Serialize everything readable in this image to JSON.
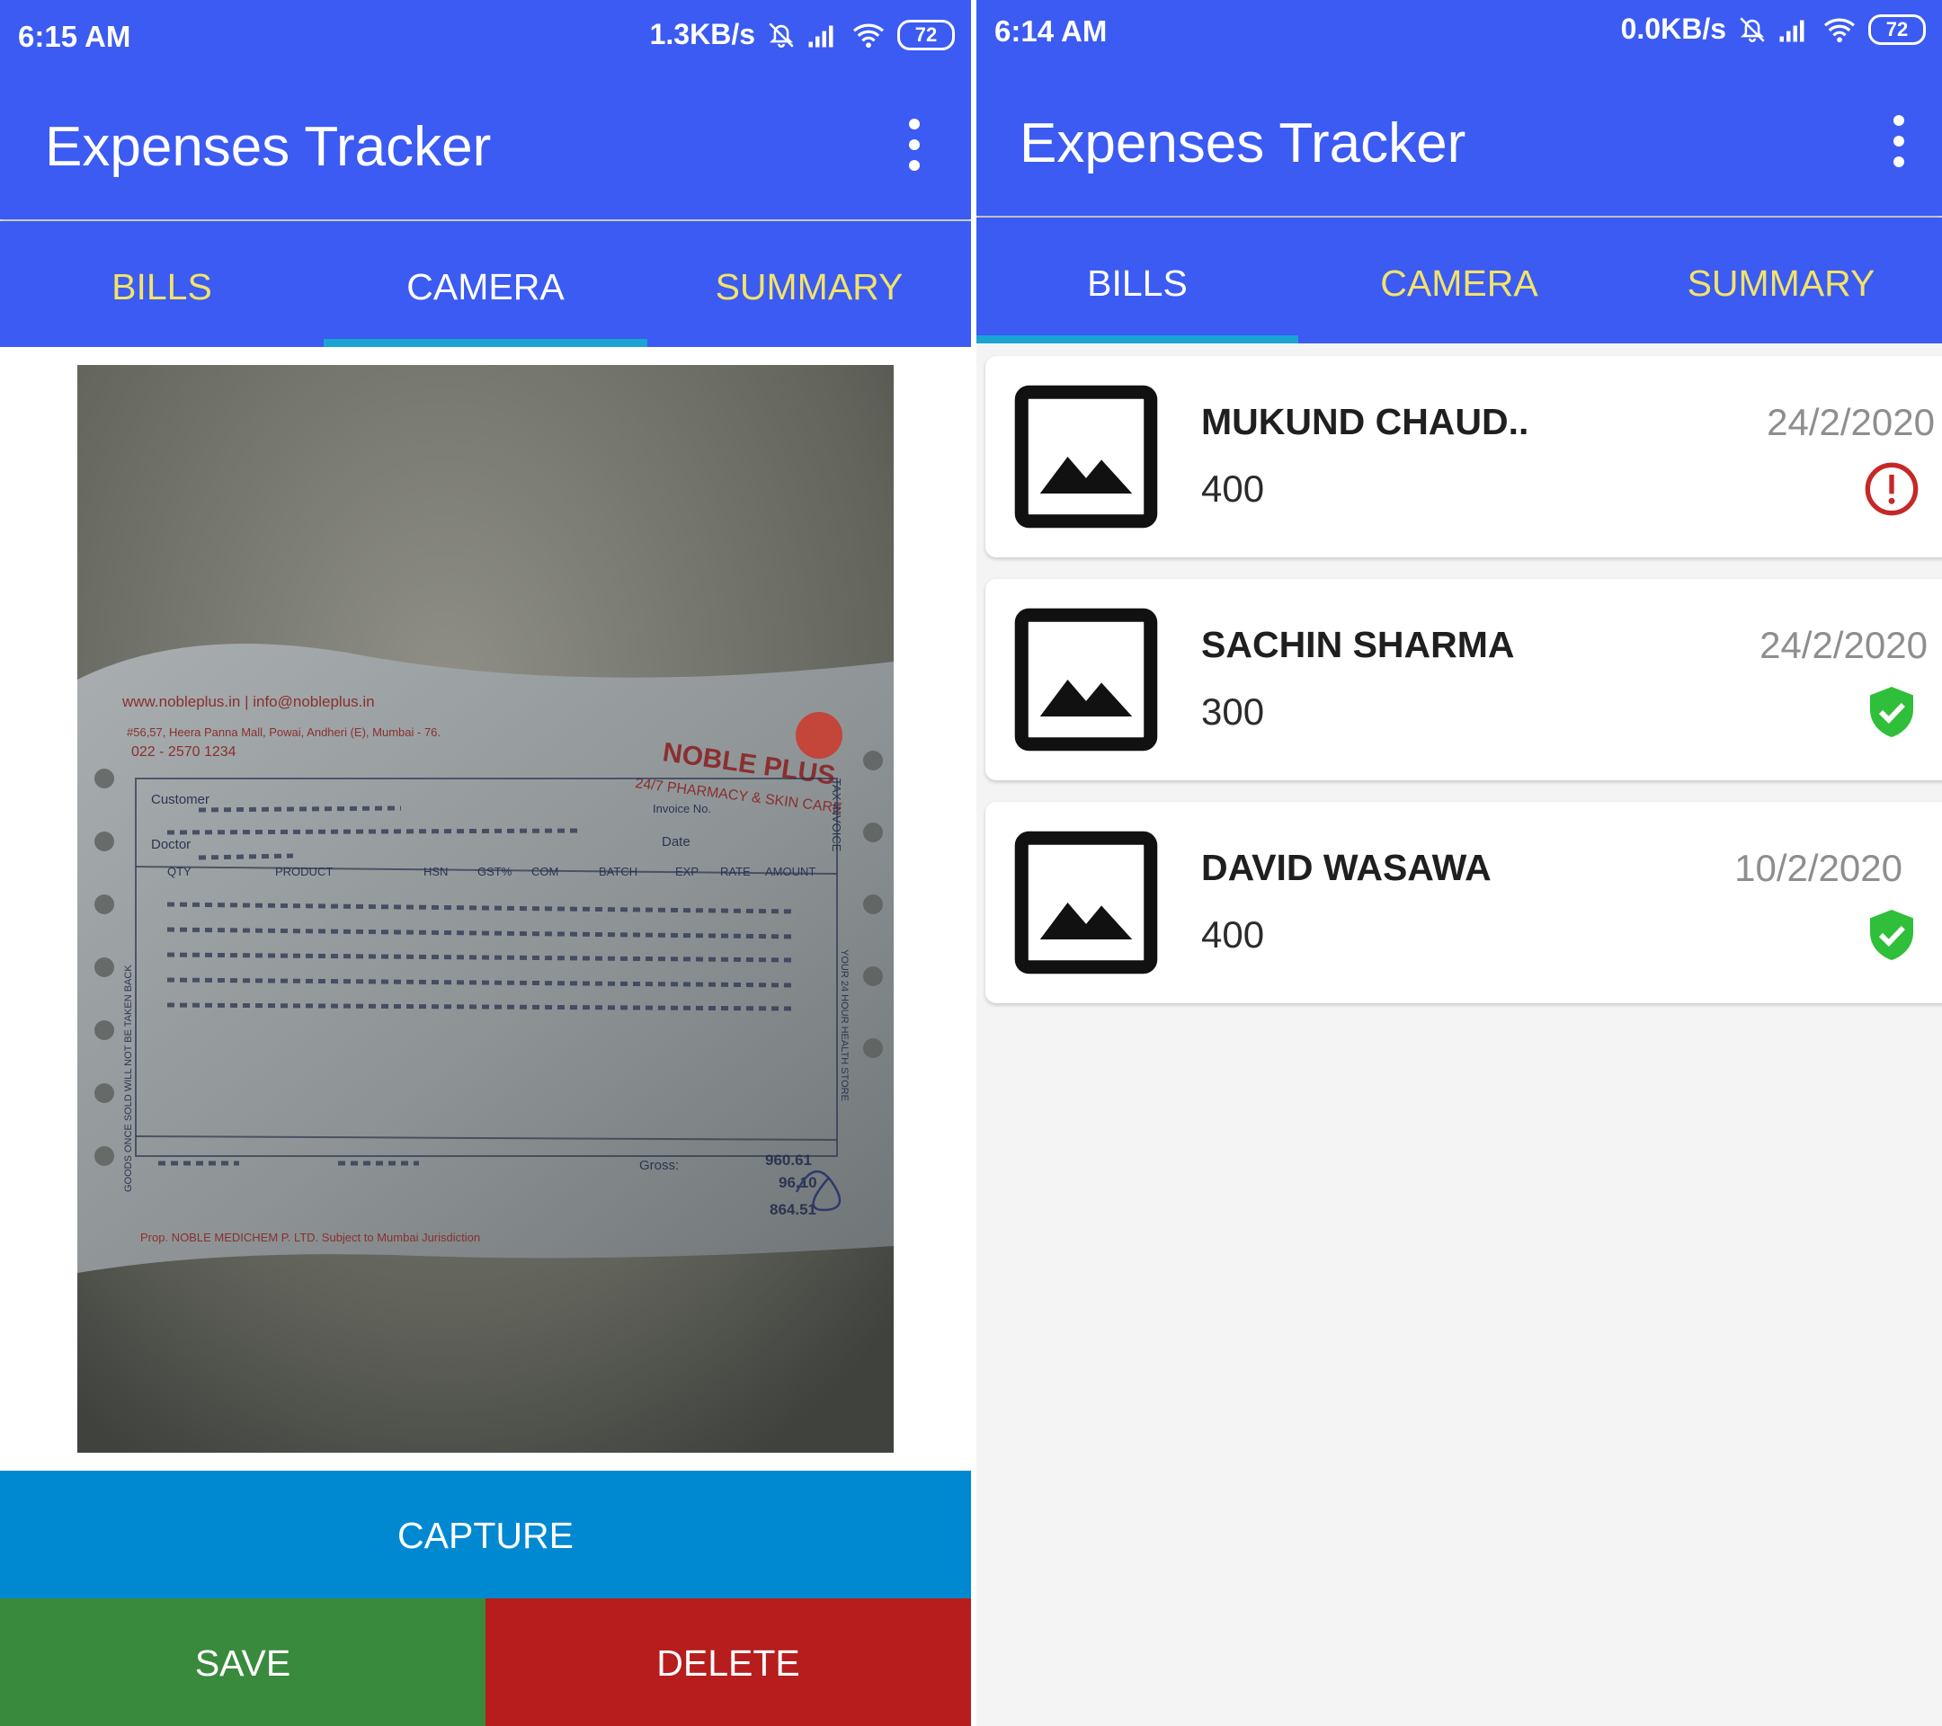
{
  "camera_screen": {
    "status_bar": {
      "time": "6:15 AM",
      "net_speed": "1.3KB/s",
      "battery": "72"
    },
    "app_bar": {
      "title": "Expenses Tracker",
      "menu_icon": "more-vert-icon"
    },
    "tabs": [
      {
        "label": "BILLS",
        "active": false
      },
      {
        "label": "CAMERA",
        "active": true
      },
      {
        "label": "SUMMARY",
        "active": false
      }
    ],
    "preview": {
      "receipt_lines": [
        "www.nobleplus.in | info@nobleplus.in",
        "#56,57, Heera Panna Mall, Powai, Andheri (E), Mumbai - 76.",
        "022 - 2570 1234",
        "NOBLE PLUS",
        "24/7 PHARMACY & SKIN CARE",
        "Customer",
        "Doctor",
        "QTY",
        "PRODUCT",
        "HSN",
        "GST%",
        "COM",
        "BATCH",
        "EXP",
        "RATE",
        "AMOUNT",
        "TAX INVOICE",
        "Invoice No.",
        "Date",
        "Gross:",
        "960.61",
        "96.10",
        "864.51",
        "Prop. NOBLE MEDICHEM P. LTD.  Subject to Mumbai Jurisdiction",
        "GOODS ONCE SOLD WILL NOT BE TAKEN BACK",
        "YOUR 24 HOUR HEALTH STORE"
      ]
    },
    "buttons": {
      "capture": "CAPTURE",
      "save": "SAVE",
      "delete": "DELETE"
    },
    "colors": {
      "capture": "#0088d1",
      "save": "#3a8a3d",
      "delete": "#b71d1d"
    }
  },
  "bills_screen": {
    "status_bar": {
      "time": "6:14 AM",
      "net_speed": "0.0KB/s",
      "battery": "72"
    },
    "app_bar": {
      "title": "Expenses Tracker",
      "menu_icon": "more-vert-icon"
    },
    "tabs": [
      {
        "label": "BILLS",
        "active": true
      },
      {
        "label": "CAMERA",
        "active": false
      },
      {
        "label": "SUMMARY",
        "active": false
      }
    ],
    "bills": [
      {
        "name": "MUKUND CHAUD..",
        "amount": "400",
        "date": "24/2/2020",
        "status": "error",
        "status_icon": "alert-circle-icon"
      },
      {
        "name": "SACHIN SHARMA",
        "amount": "300",
        "date": "24/2/2020",
        "status": "verified",
        "status_icon": "shield-check-icon"
      },
      {
        "name": "DAVID WASAWA",
        "amount": "400",
        "date": "10/2/2020",
        "status": "verified",
        "status_icon": "shield-check-icon"
      }
    ]
  },
  "theme": {
    "primary": "#3b5bf2",
    "tab_inactive": "#f2e36a",
    "tab_indicator": "#1aa3d3",
    "error": "#c62828",
    "success": "#2fbf3a"
  }
}
